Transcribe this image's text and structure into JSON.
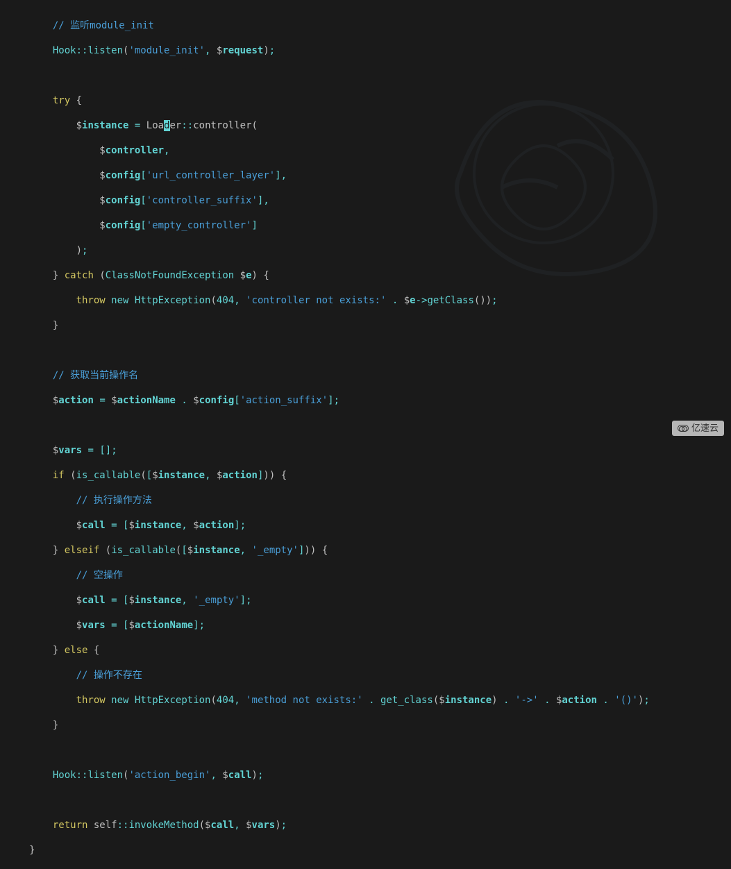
{
  "code": {
    "l1_comment": "// 监听module_init",
    "l2_hook": "Hook",
    "l2_listen": "listen",
    "l2_str": "'module_init'",
    "l2_req": "request",
    "l3_try": "try",
    "l4_inst": "instance",
    "l4_loa": "Loa",
    "l4_d": "d",
    "l4_er": "er",
    "l4_ctrl": "controller",
    "l5_ctrl": "controller",
    "l6_cfg": "config",
    "l6_str": "'url_controller_layer'",
    "l7_cfg": "config",
    "l7_str": "'controller_suffix'",
    "l8_cfg": "config",
    "l8_str": "'empty_controller'",
    "l10_catch": "catch",
    "l10_cls": "ClassNotFoundException",
    "l10_e": "e",
    "l11_throw": "throw",
    "l11_new": "new",
    "l11_http": "HttpException",
    "l11_404": "404",
    "l11_str": "'controller not exists:'",
    "l11_e2": "e",
    "l11_get": "getClass",
    "l13_comment": "// 获取当前操作名",
    "l14_action": "action",
    "l14_aname": "actionName",
    "l14_cfg": "config",
    "l14_str": "'action_suffix'",
    "l15_vars": "vars",
    "l16_if": "if",
    "l16_isc": "is_callable",
    "l16_inst": "instance",
    "l16_act": "action",
    "l17_comment": "// 执行操作方法",
    "l18_call": "call",
    "l18_inst": "instance",
    "l18_act": "action",
    "l19_elseif": "elseif",
    "l19_isc": "is_callable",
    "l19_inst": "instance",
    "l19_str": "'_empty'",
    "l20_comment": "// 空操作",
    "l21_call": "call",
    "l21_inst": "instance",
    "l21_str": "'_empty'",
    "l22_vars": "vars",
    "l22_aname": "actionName",
    "l23_else": "else",
    "l24_comment": "// 操作不存在",
    "l25_throw": "throw",
    "l25_new": "new",
    "l25_http": "HttpException",
    "l25_404": "404",
    "l25_str": "'method not exists:'",
    "l25_gc": "get_class",
    "l25_inst": "instance",
    "l25_arrow": "'->'",
    "l25_act": "action",
    "l25_paren": "'()'",
    "l27_hook": "Hook",
    "l27_listen": "listen",
    "l27_str": "'action_begin'",
    "l27_call": "call",
    "l28_return": "return",
    "l28_self": "self",
    "l28_invoke": "invokeMethod",
    "l28_call": "call",
    "l28_vars": "vars"
  },
  "watermark": "亿速云"
}
